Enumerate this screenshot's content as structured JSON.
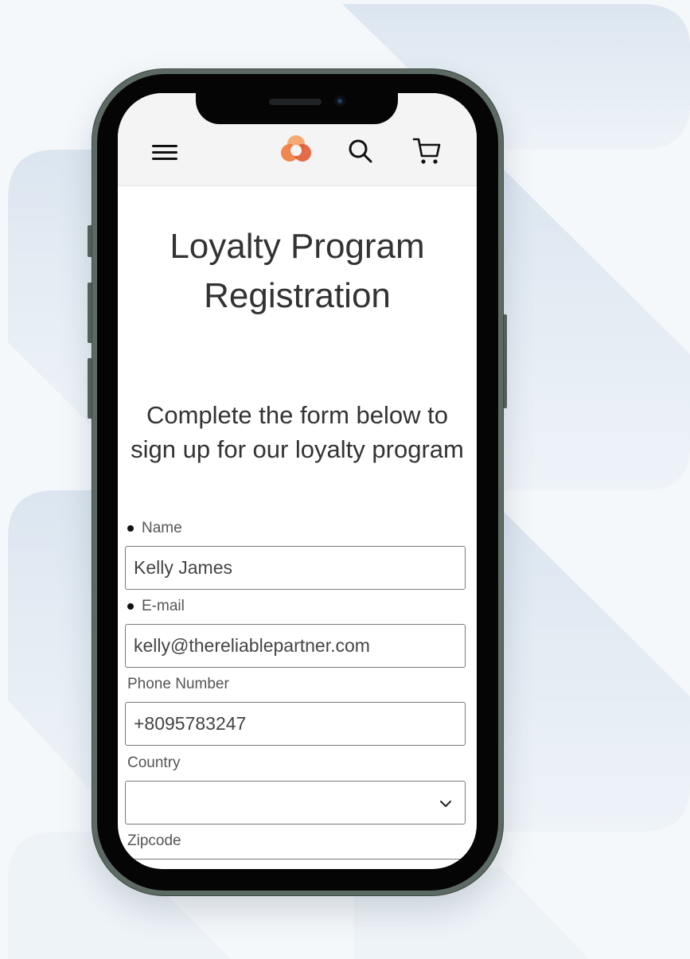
{
  "header": {
    "menu_icon": "hamburger-menu-icon",
    "logo_icon": "brand-logo-icon",
    "search_icon": "search-icon",
    "cart_icon": "shopping-cart-icon",
    "logo_colors": [
      "#f07b3f",
      "#e2542a",
      "#f5a36b"
    ]
  },
  "page": {
    "title": "Loyalty Program Registration",
    "subtitle": "Complete the form below to sign up for our loyalty program"
  },
  "form": {
    "name": {
      "label": "Name",
      "required": true,
      "value": "Kelly James"
    },
    "email": {
      "label": "E-mail",
      "required": true,
      "value": "kelly@thereliablepartner.com"
    },
    "phone": {
      "label": "Phone Number",
      "required": false,
      "value": "+8095783247"
    },
    "country": {
      "label": "Country",
      "required": false,
      "value": ""
    },
    "zipcode": {
      "label": "Zipcode",
      "required": false,
      "value": ""
    }
  },
  "colors": {
    "background_shape": "#dfe8f1",
    "phone_frame": "#5d6a63",
    "header_bg": "#f4f4f4",
    "text": "#333333"
  }
}
